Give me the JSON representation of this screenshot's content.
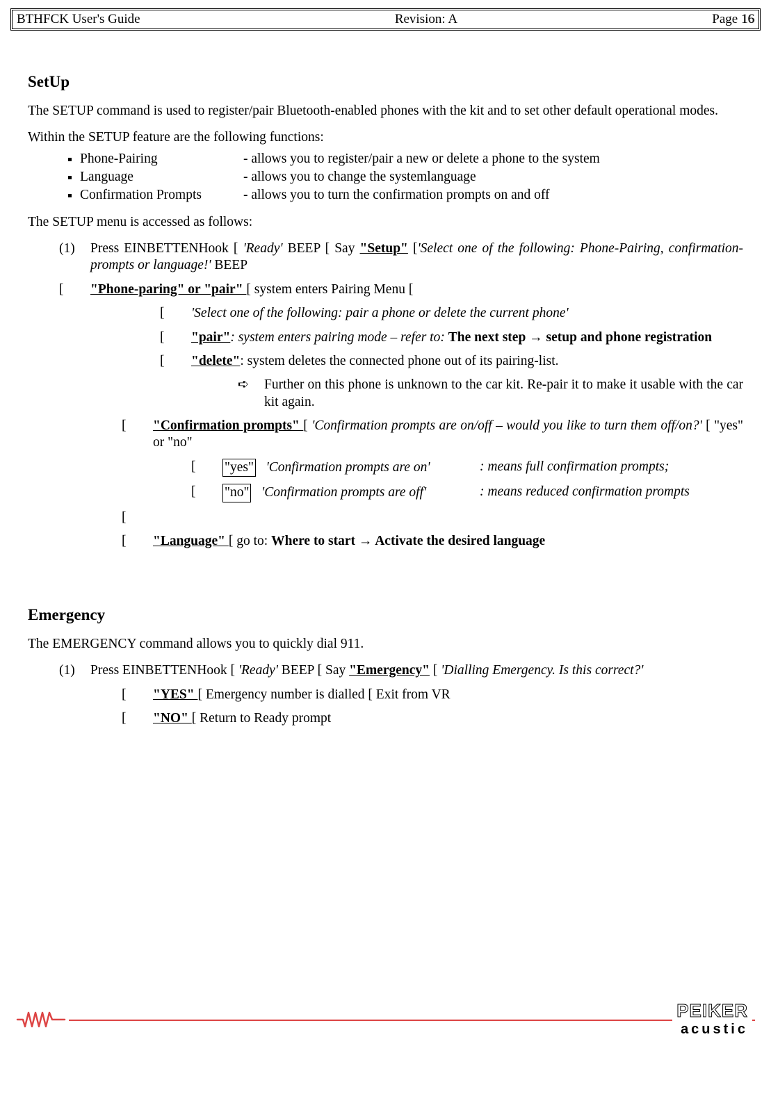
{
  "header": {
    "left": "BTHFCK  User's Guide",
    "center": "Revision: A",
    "right_label": "Page ",
    "page_number": "16"
  },
  "setup": {
    "title": "SetUp",
    "intro": "The SETUP command is used to register/pair Bluetooth-enabled phones with the kit and to set other default operational modes.",
    "funcs_intro": "Within the SETUP feature are the following functions:",
    "funcs": [
      {
        "name": "Phone-Pairing",
        "desc": "- allows you to register/pair a new or delete a phone to the system"
      },
      {
        "name": "Language",
        "desc": "- allows you to change the systemlanguage"
      },
      {
        "name": "Confirmation Prompts",
        "desc": "- allows you to turn the confirmation prompts on and off"
      }
    ],
    "accessed": "The SETUP menu is accessed as follows:",
    "step1_mark": "(1)",
    "step1_pre": "Press   EINBETTENHook  [  ",
    "step1_ready": "'Ready'",
    "step1_mid": "  BEEP  [  Say  ",
    "step1_setup": "\"Setup\"",
    "step1_post": "  [",
    "step1_prompt": "'Select  one  of  the  following:  Phone-Pairing, confirmation-prompts or language!'",
    "step1_end": " BEEP",
    "pp_mark": "[",
    "pp_label": "\"Phone-paring\" or \"pair\" ",
    "pp_after": "[ system enters Pairing Menu [",
    "pp_sub_mark": "[",
    "pp_sub_prompt": "'Select one of the following: pair a phone or delete the current phone'",
    "pair_mark": "[",
    "pair_label": "\"pair\"",
    "pair_after1": ":  system  enters  pairing  mode  –  refer  to:  ",
    "pair_after2": "The  next  step  →  setup  and  phone registration",
    "del_mark": "[",
    "del_label": "\"delete\"",
    "del_after": ": system deletes the connected phone out of its pairing-list.",
    "arrow_mark": "➪",
    "arrow_text": "Further on this phone is unknown to the car kit. Re-pair it to make it usable with the car kit again.",
    "cp_mark": "[",
    "cp_label": "\"Confirmation prompts\" ",
    "cp_after1": "[  ",
    "cp_prompt": "'Confirmation prompts are on/off – would you like to turn them off/on?'",
    "cp_after2": " [ \"yes\" or  \"no\"",
    "cp_yes_mark": "[",
    "cp_yes_box": "\"yes\"",
    "cp_yes_left": "'Confirmation prompts are on'",
    "cp_yes_right": ": means full confirmation prompts;",
    "cp_no_mark": "[",
    "cp_no_box": "\"no\"",
    "cp_no_left": "'Confirmation prompts are off'",
    "cp_no_right": ": means reduced confirmation prompts",
    "empty_mark": "[",
    "lang_mark": "[",
    "lang_label": "\"Language\" ",
    "lang_after1": "[ go to: ",
    "lang_after2": "Where to start → Activate the desired language"
  },
  "emergency": {
    "title": "Emergency",
    "intro": "The EMERGENCY command allows you to quickly dial 911.",
    "step_mark": "(1)",
    "step_pre": "Press EINBETTENHook  [ ",
    "step_ready": "'Ready'",
    "step_mid": " BEEP [ Say ",
    "step_cmd": "\"Emergency\"",
    "step_post": " [ ",
    "step_prompt": "'Dialling Emergency. Is this correct?'",
    "yes_mark": "[",
    "yes_label": "\"YES\" ",
    "yes_after": "[ Emergency number is dialled [ Exit from VR",
    "no_mark": "[",
    "no_label": "\"NO\" ",
    "no_after": "[ Return to Ready prompt"
  },
  "footer": {
    "logo_line1": "PEIKER",
    "logo_line2": "acustic"
  }
}
